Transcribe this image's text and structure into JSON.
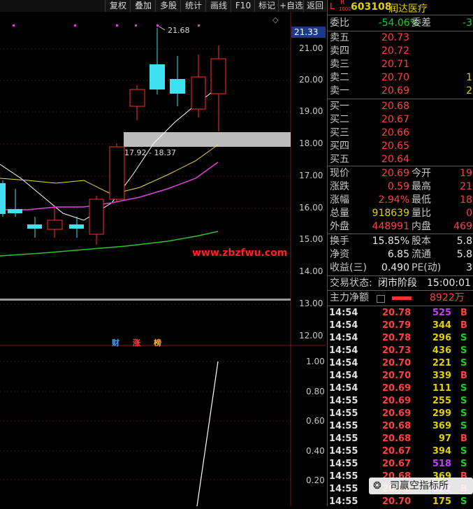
{
  "toolbar": {
    "items": [
      "复权",
      "叠加",
      "多股",
      "统计",
      "画线",
      "F10",
      "标记",
      "+自选",
      "返回"
    ]
  },
  "chart": {
    "price_axis": [
      "21.00",
      "20.00",
      "19.00",
      "18.00",
      "17.00",
      "16.00",
      "15.00",
      "14.00",
      "13.00",
      "12.00"
    ],
    "current_price": "21.33",
    "high_marker": "21.68",
    "zone_label": "17.92 - 18.37",
    "watermark_url": "www.zbzfwu.com",
    "tags": [
      "财",
      "涨",
      "榜"
    ],
    "sub_axis": [
      "1.00",
      "0.80",
      "0.60",
      "0.40",
      "0.20"
    ],
    "colors": {
      "up": "#ff3030",
      "down": "#40e0f0",
      "ma5": "#ffffff",
      "ma10": "#e8e040",
      "ma20": "#e040e0",
      "ma60": "#30c030"
    }
  },
  "panel": {
    "code": "603108",
    "name": "润达医疗",
    "badge_l": "L",
    "badge_r": "R",
    "badge_num": "1000",
    "weibi_label": "委比",
    "weibi": "-54.06%",
    "weicha_label": "委差",
    "weicha": "-3",
    "asks": [
      {
        "label": "卖五",
        "price": "20.73",
        "vol": ""
      },
      {
        "label": "卖四",
        "price": "20.72",
        "vol": ""
      },
      {
        "label": "卖三",
        "price": "20.71",
        "vol": ""
      },
      {
        "label": "卖二",
        "price": "20.70",
        "vol": "1"
      },
      {
        "label": "卖一",
        "price": "20.69",
        "vol": "2"
      }
    ],
    "bids": [
      {
        "label": "买一",
        "price": "20.68"
      },
      {
        "label": "买二",
        "price": "20.67"
      },
      {
        "label": "买三",
        "price": "20.66"
      },
      {
        "label": "买四",
        "price": "20.65"
      },
      {
        "label": "买五",
        "price": "20.64"
      }
    ],
    "stats": [
      {
        "l1": "现价",
        "v1": "20.69",
        "c1": "red",
        "l2": "今开",
        "v2": "19"
      },
      {
        "l1": "涨跌",
        "v1": "0.59",
        "c1": "red",
        "l2": "最高",
        "v2": "21"
      },
      {
        "l1": "涨幅",
        "v1": "2.94%",
        "c1": "red",
        "l2": "最低",
        "v2": "18"
      },
      {
        "l1": "总量",
        "v1": "918639",
        "c1": "yellow",
        "l2": "量比",
        "v2": "0"
      },
      {
        "l1": "外盘",
        "v1": "448991",
        "c1": "red",
        "l2": "内盘",
        "v2": "469"
      }
    ],
    "stats2": [
      {
        "l1": "换手",
        "v1": "15.85%",
        "l2": "股本",
        "v2": "5.8"
      },
      {
        "l1": "净资",
        "v1": "6.85",
        "l2": "流通",
        "v2": "5.8"
      },
      {
        "l1": "收益(三)",
        "v1": "0.490",
        "l2": "PE(动)",
        "v2": "3"
      }
    ],
    "trade_status_label": "交易状态:",
    "trade_status": "闭市阶段",
    "trade_time": "15:00:01",
    "net_label": "主力净额",
    "net_value": "8922万",
    "ticks": [
      {
        "t": "14:54",
        "p": "20.78",
        "v": "525",
        "d": "B",
        "pc": "red",
        "vc": "purple"
      },
      {
        "t": "14:54",
        "p": "20.79",
        "v": "344",
        "d": "B",
        "pc": "red",
        "vc": "yellow"
      },
      {
        "t": "14:54",
        "p": "20.78",
        "v": "296",
        "d": "S",
        "pc": "red",
        "vc": "yellow"
      },
      {
        "t": "14:54",
        "p": "20.73",
        "v": "436",
        "d": "S",
        "pc": "red",
        "vc": "yellow"
      },
      {
        "t": "14:54",
        "p": "20.70",
        "v": "221",
        "d": "S",
        "pc": "red",
        "vc": "yellow"
      },
      {
        "t": "14:54",
        "p": "20.70",
        "v": "339",
        "d": "B",
        "pc": "red",
        "vc": "yellow"
      },
      {
        "t": "14:54",
        "p": "20.69",
        "v": "111",
        "d": "S",
        "pc": "red",
        "vc": "yellow"
      },
      {
        "t": "14:55",
        "p": "20.69",
        "v": "255",
        "d": "S",
        "pc": "red",
        "vc": "yellow"
      },
      {
        "t": "14:55",
        "p": "20.69",
        "v": "299",
        "d": "S",
        "pc": "red",
        "vc": "yellow"
      },
      {
        "t": "14:55",
        "p": "20.68",
        "v": "369",
        "d": "S",
        "pc": "red",
        "vc": "yellow"
      },
      {
        "t": "14:55",
        "p": "20.68",
        "v": "97",
        "d": "B",
        "pc": "red",
        "vc": "yellow"
      },
      {
        "t": "14:55",
        "p": "20.67",
        "v": "394",
        "d": "S",
        "pc": "red",
        "vc": "yellow"
      },
      {
        "t": "14:55",
        "p": "20.67",
        "v": "518",
        "d": "S",
        "pc": "red",
        "vc": "purple"
      },
      {
        "t": "14:55",
        "p": "20.68",
        "v": "369",
        "d": "B",
        "pc": "red",
        "vc": "yellow"
      },
      {
        "t": "14:55",
        "p": "20.70",
        "v": "622",
        "d": "B",
        "pc": "red",
        "vc": "purple"
      },
      {
        "t": "14:55",
        "p": "20.70",
        "v": "175",
        "d": "S",
        "pc": "red",
        "vc": "yellow"
      }
    ],
    "watermark": "司赢空指标所"
  }
}
